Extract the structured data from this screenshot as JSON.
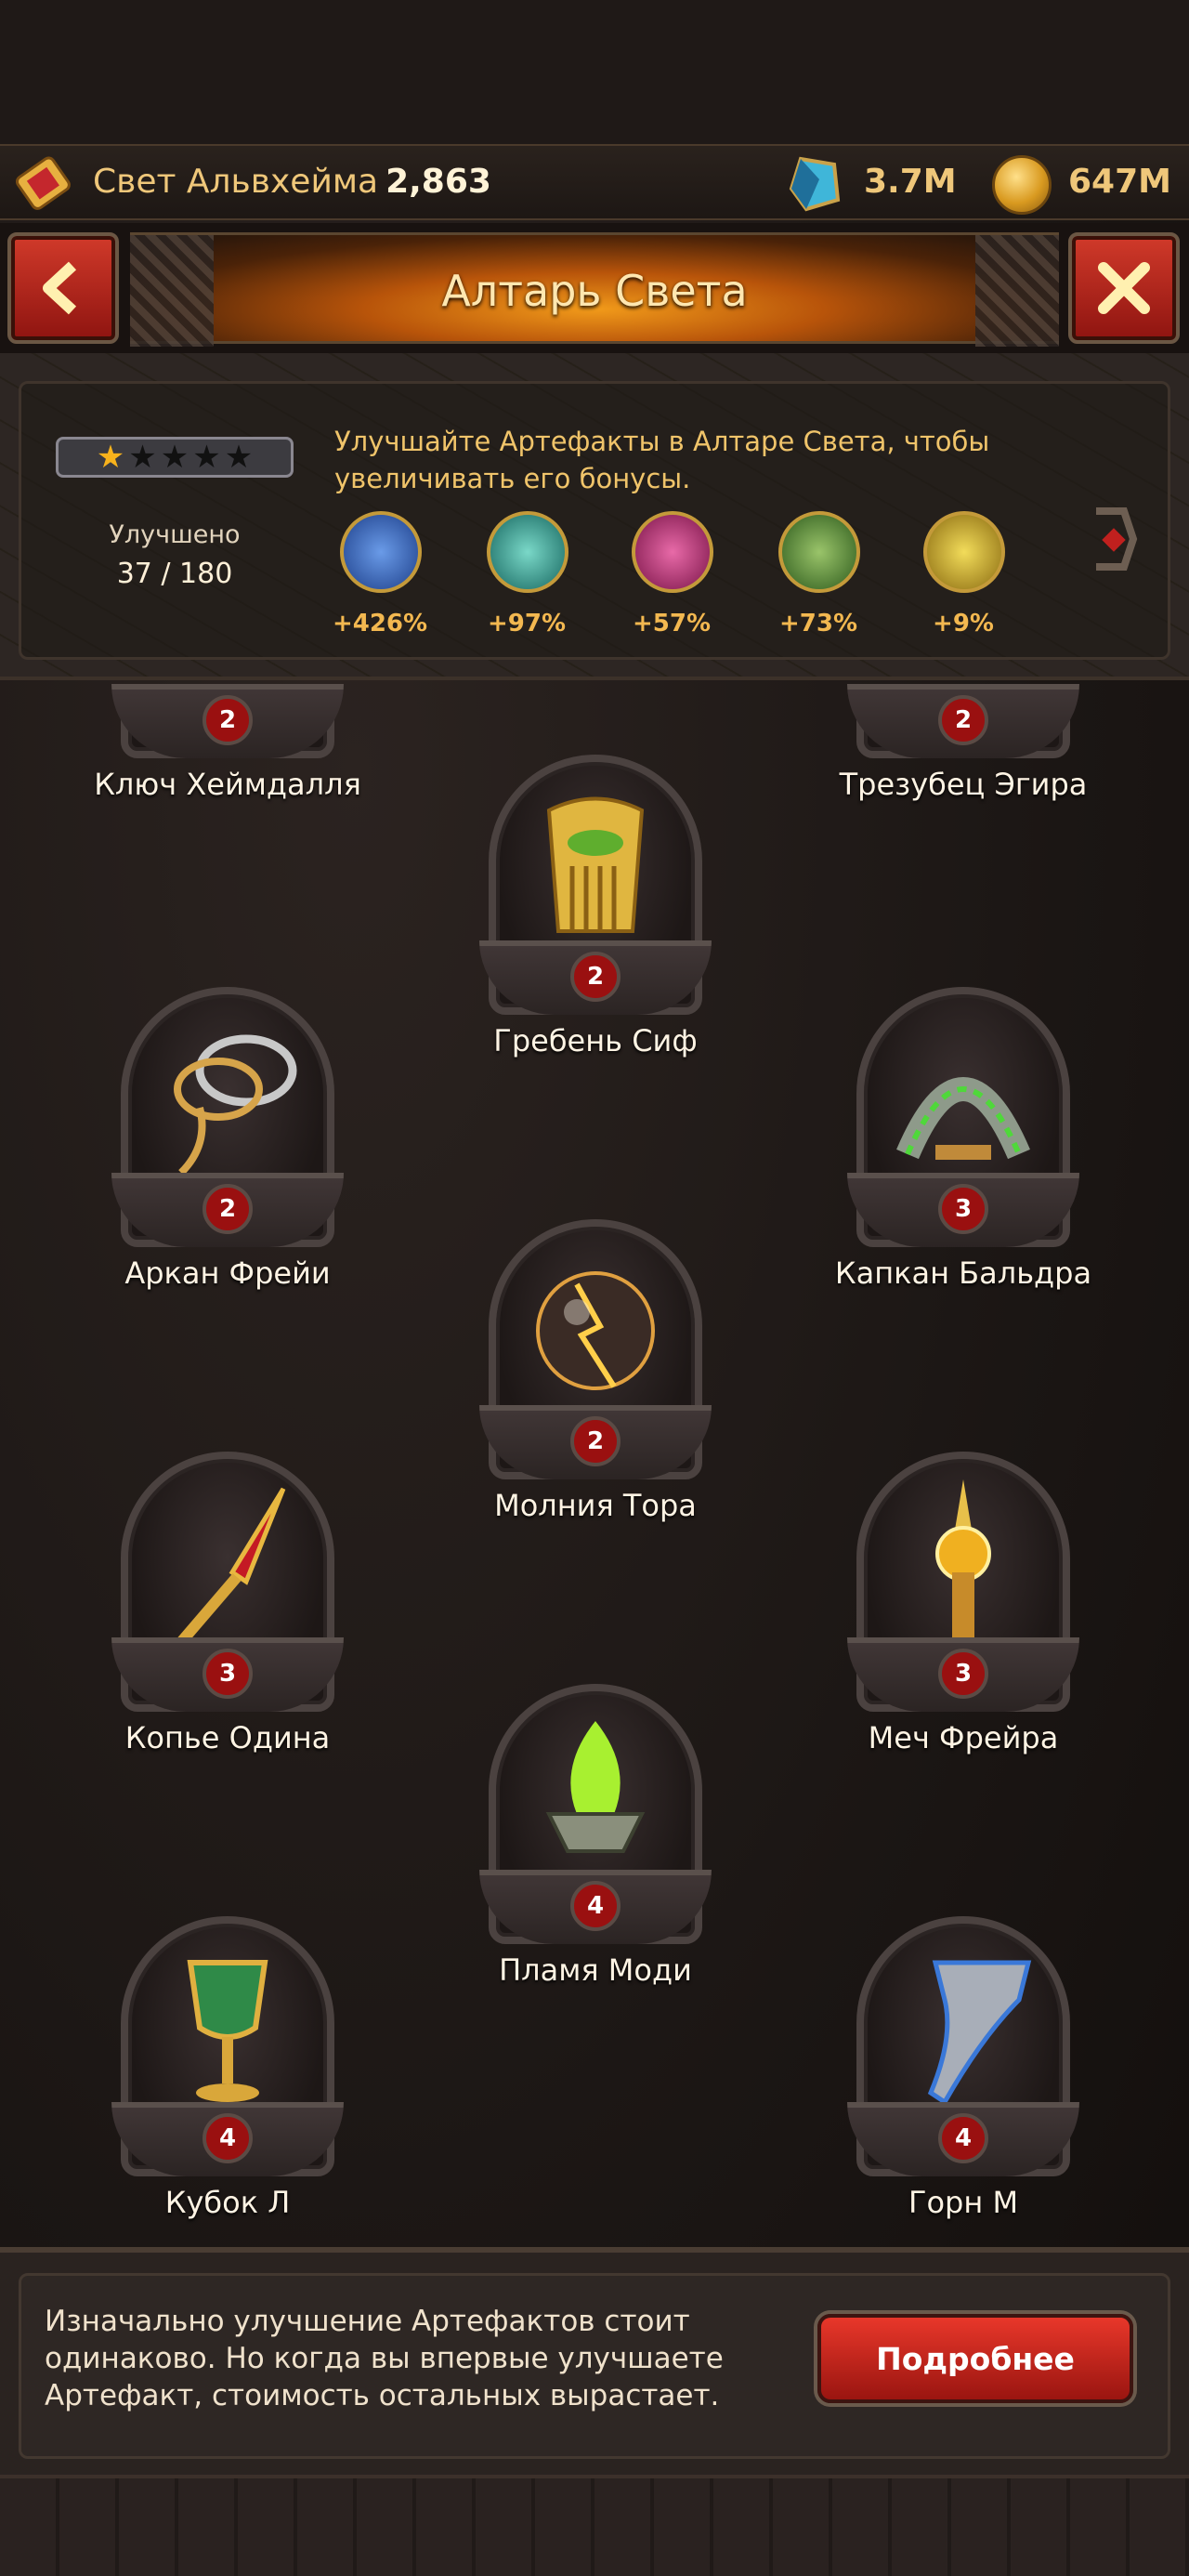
{
  "resources": {
    "light_label": "Свет Альвхейма",
    "light_value": "2,863",
    "crystals": "3.7M",
    "coins": "647M"
  },
  "title": "Алтарь Света",
  "panel": {
    "stars_filled": 1,
    "stars_total": 5,
    "upgraded_label": "Улучшено",
    "upgraded_count": "37 / 180",
    "text": "Улучшайте Артефакты в Алтаре Света, чтобы увеличивать его бонусы.",
    "bonuses": [
      {
        "value": "+426%",
        "color": "#3a6fd0"
      },
      {
        "value": "+97%",
        "color": "#2aa7a0"
      },
      {
        "value": "+57%",
        "color": "#c0307a"
      },
      {
        "value": "+73%",
        "color": "#4a8a3a"
      },
      {
        "value": "+9%",
        "color": "#d4b21a"
      }
    ]
  },
  "artifacts": [
    {
      "name": "Ключ Хеймдалля",
      "level": "2",
      "icon": "key-icon"
    },
    {
      "name": "Трезубец Эгира",
      "level": "2",
      "icon": "trident-icon"
    },
    {
      "name": "Гребень Сиф",
      "level": "2",
      "icon": "comb-icon"
    },
    {
      "name": "Аркан Фрейи",
      "level": "2",
      "icon": "lasso-icon"
    },
    {
      "name": "Капкан Бальдра",
      "level": "3",
      "icon": "trap-icon"
    },
    {
      "name": "Молния Тора",
      "level": "2",
      "icon": "lightning-orb-icon"
    },
    {
      "name": "Копье Одина",
      "level": "3",
      "icon": "spear-icon"
    },
    {
      "name": "Меч Фрейра",
      "level": "3",
      "icon": "sword-icon"
    },
    {
      "name": "Пламя Моди",
      "level": "4",
      "icon": "flame-brazier-icon"
    },
    {
      "name": "Кубок Л",
      "level": "4",
      "icon": "goblet-icon"
    },
    {
      "name": "Горн М",
      "level": "4",
      "icon": "horn-icon"
    }
  ],
  "footer": {
    "text": "Изначально улучшение Артефактов стоит одинаково. Но когда вы впервые улучшаете Артефакт, стоимость остальных вырастает.",
    "button": "Подробнее"
  }
}
